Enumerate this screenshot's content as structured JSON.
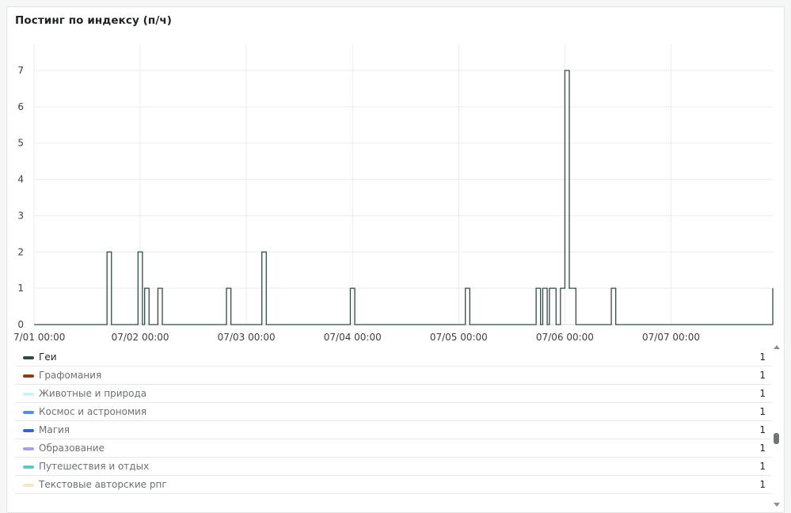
{
  "panel": {
    "title": "Постинг по индексу (п/ч)"
  },
  "chart_data": {
    "type": "line",
    "title": "Постинг по индексу (п/ч)",
    "step": true,
    "x_tick_labels": [
      "7/01 00:00",
      "07/02 00:00",
      "07/03 00:00",
      "07/04 00:00",
      "07/05 00:00",
      "07/06 00:00",
      "07/07 00:00"
    ],
    "y_ticks": [
      0,
      1,
      2,
      3,
      4,
      5,
      6,
      7
    ],
    "ylim": [
      0,
      7
    ],
    "xlim_hours": [
      0,
      167
    ],
    "grid": true,
    "series": [
      {
        "name": "Геи",
        "color": "#2f4a4a",
        "points": [
          [
            0,
            0
          ],
          [
            16.5,
            2
          ],
          [
            17.5,
            0
          ],
          [
            23.5,
            2
          ],
          [
            24.5,
            0
          ],
          [
            25,
            1
          ],
          [
            26,
            0
          ],
          [
            28,
            1
          ],
          [
            29,
            0
          ],
          [
            43.5,
            1
          ],
          [
            44.5,
            0
          ],
          [
            51.5,
            2
          ],
          [
            52.5,
            0
          ],
          [
            71.5,
            1
          ],
          [
            72.5,
            0
          ],
          [
            97.5,
            1
          ],
          [
            98.5,
            0
          ],
          [
            113.5,
            1
          ],
          [
            114.5,
            0
          ],
          [
            115,
            1
          ],
          [
            116,
            0
          ],
          [
            116.5,
            1
          ],
          [
            118,
            0
          ],
          [
            119,
            1
          ],
          [
            120,
            7
          ],
          [
            121,
            1
          ],
          [
            122.5,
            0
          ],
          [
            130.5,
            1
          ],
          [
            131.5,
            0
          ],
          [
            167,
            1
          ]
        ]
      }
    ],
    "legend_placement": "bottom"
  },
  "legend": {
    "items": [
      {
        "label": "Геи",
        "value": "1",
        "color": "#2f4a4a"
      },
      {
        "label": "Графомания",
        "value": "1",
        "color": "#8b3e14"
      },
      {
        "label": "Животные и природа",
        "value": "1",
        "color": "#c9f3f8"
      },
      {
        "label": "Космос и астрономия",
        "value": "1",
        "color": "#5c8fd8"
      },
      {
        "label": "Магия",
        "value": "1",
        "color": "#3366cc"
      },
      {
        "label": "Образование",
        "value": "1",
        "color": "#a89ee0"
      },
      {
        "label": "Путешествия и отдых",
        "value": "1",
        "color": "#5fc4c4"
      },
      {
        "label": "Текстовые авторские рпг",
        "value": "1",
        "color": "#f7e6c4"
      }
    ]
  }
}
